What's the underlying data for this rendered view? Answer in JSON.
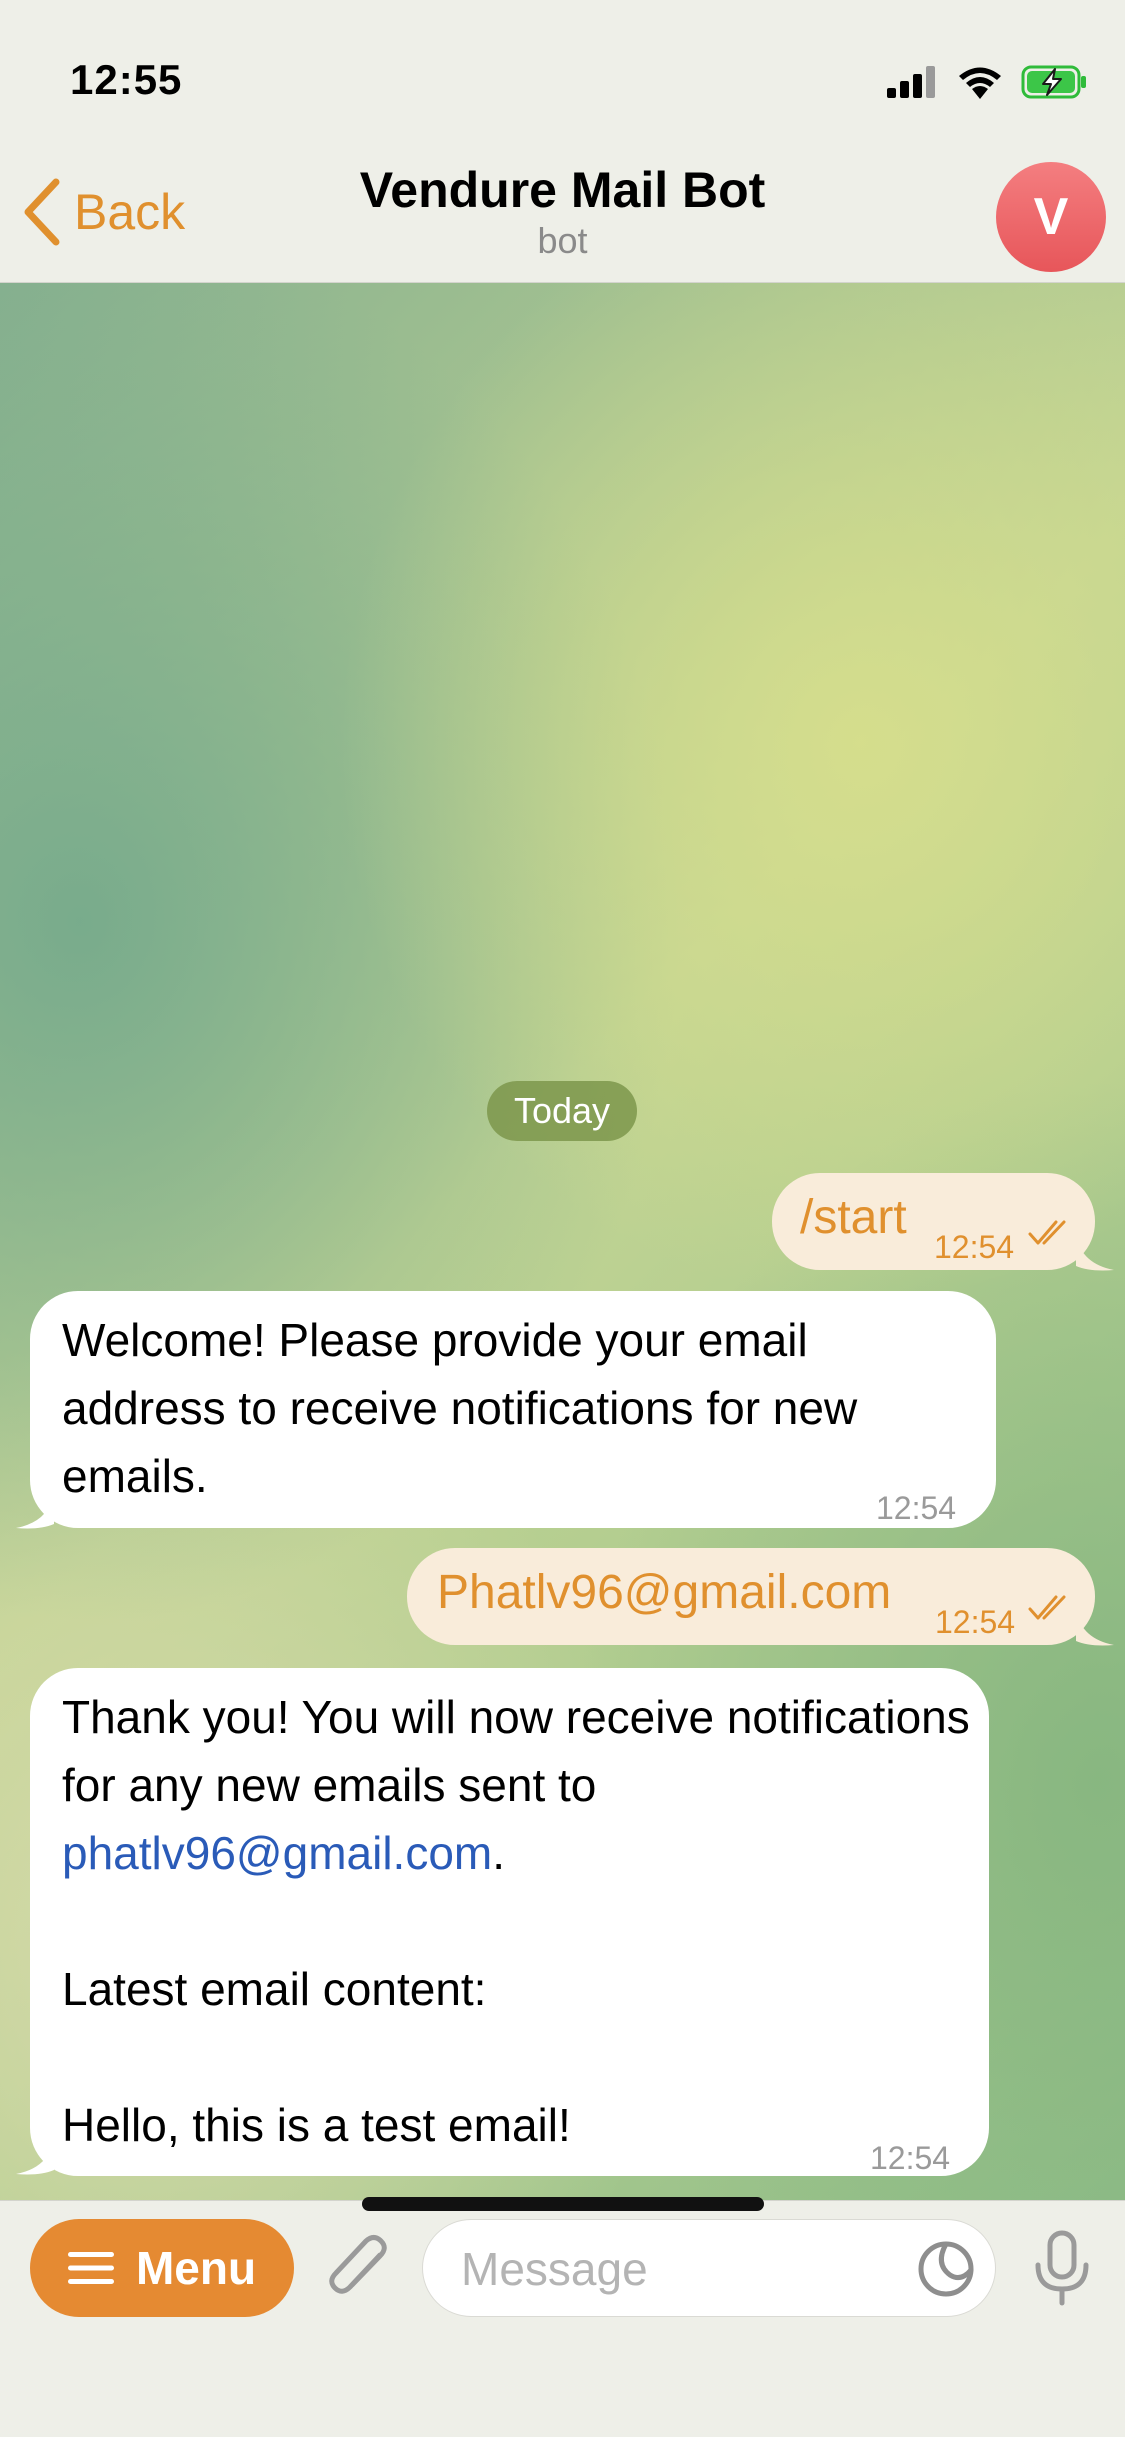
{
  "status_bar": {
    "time": "12:55"
  },
  "header": {
    "back_label": "Back",
    "title": "Vendure Mail Bot",
    "subtitle": "bot",
    "avatar_letter": "V"
  },
  "chat": {
    "date_label": "Today",
    "messages": [
      {
        "direction": "outgoing",
        "text": "/start",
        "time": "12:54",
        "read": true
      },
      {
        "direction": "incoming",
        "text": "Welcome! Please provide your email address to receive notifications for new emails.",
        "time": "12:54"
      },
      {
        "direction": "outgoing",
        "text": "Phatlv96@gmail.com",
        "time": "12:54",
        "read": true
      },
      {
        "direction": "incoming",
        "text_before_link": "Thank you! You will now receive notifications for any new emails sent to",
        "link": "phatlv96@gmail.com",
        "text_after_link": ".",
        "text_line_2": "Latest email content:",
        "text_line_3": "Hello, this is a test email!",
        "time": "12:54"
      }
    ]
  },
  "input_bar": {
    "menu_label": "Menu",
    "message_placeholder": "Message",
    "message_value": ""
  },
  "colors": {
    "accent": "#e0902e",
    "menu_button": "#e58a32",
    "outgoing_bubble": "#f9ecda",
    "incoming_bubble": "#ffffff",
    "link": "#2a5bb8",
    "avatar": "#ee6a6d"
  }
}
